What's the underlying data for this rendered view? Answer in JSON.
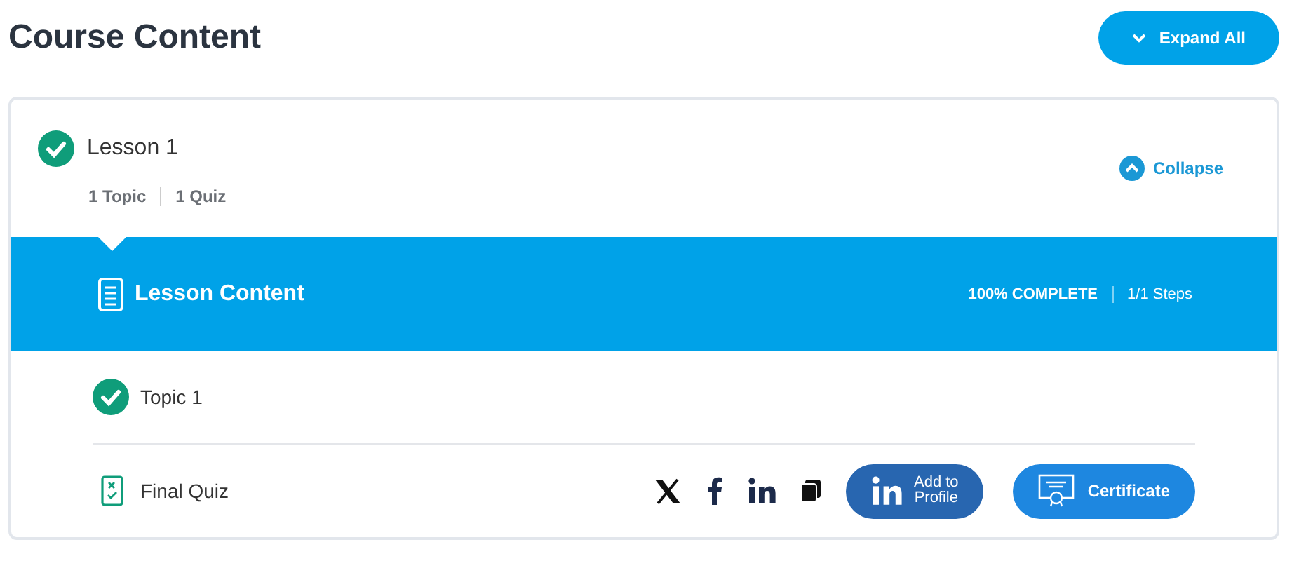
{
  "title": "Course Content",
  "expand_button": {
    "label": "Expand All"
  },
  "lesson": {
    "title": "Lesson 1",
    "completed": true,
    "meta": [
      "1 Topic",
      "1 Quiz"
    ],
    "collapse_label": "Collapse",
    "expanded": true,
    "content_bar": {
      "title": "Lesson Content",
      "progress": "100% COMPLETE",
      "steps": "1/1 Steps"
    },
    "items": [
      {
        "kind": "topic",
        "label": "Topic 1",
        "completed": true
      },
      {
        "kind": "quiz",
        "label": "Final Quiz"
      }
    ]
  },
  "share": {
    "profile_button": [
      "Add to",
      "Profile"
    ],
    "certificate_button": "Certificate"
  }
}
